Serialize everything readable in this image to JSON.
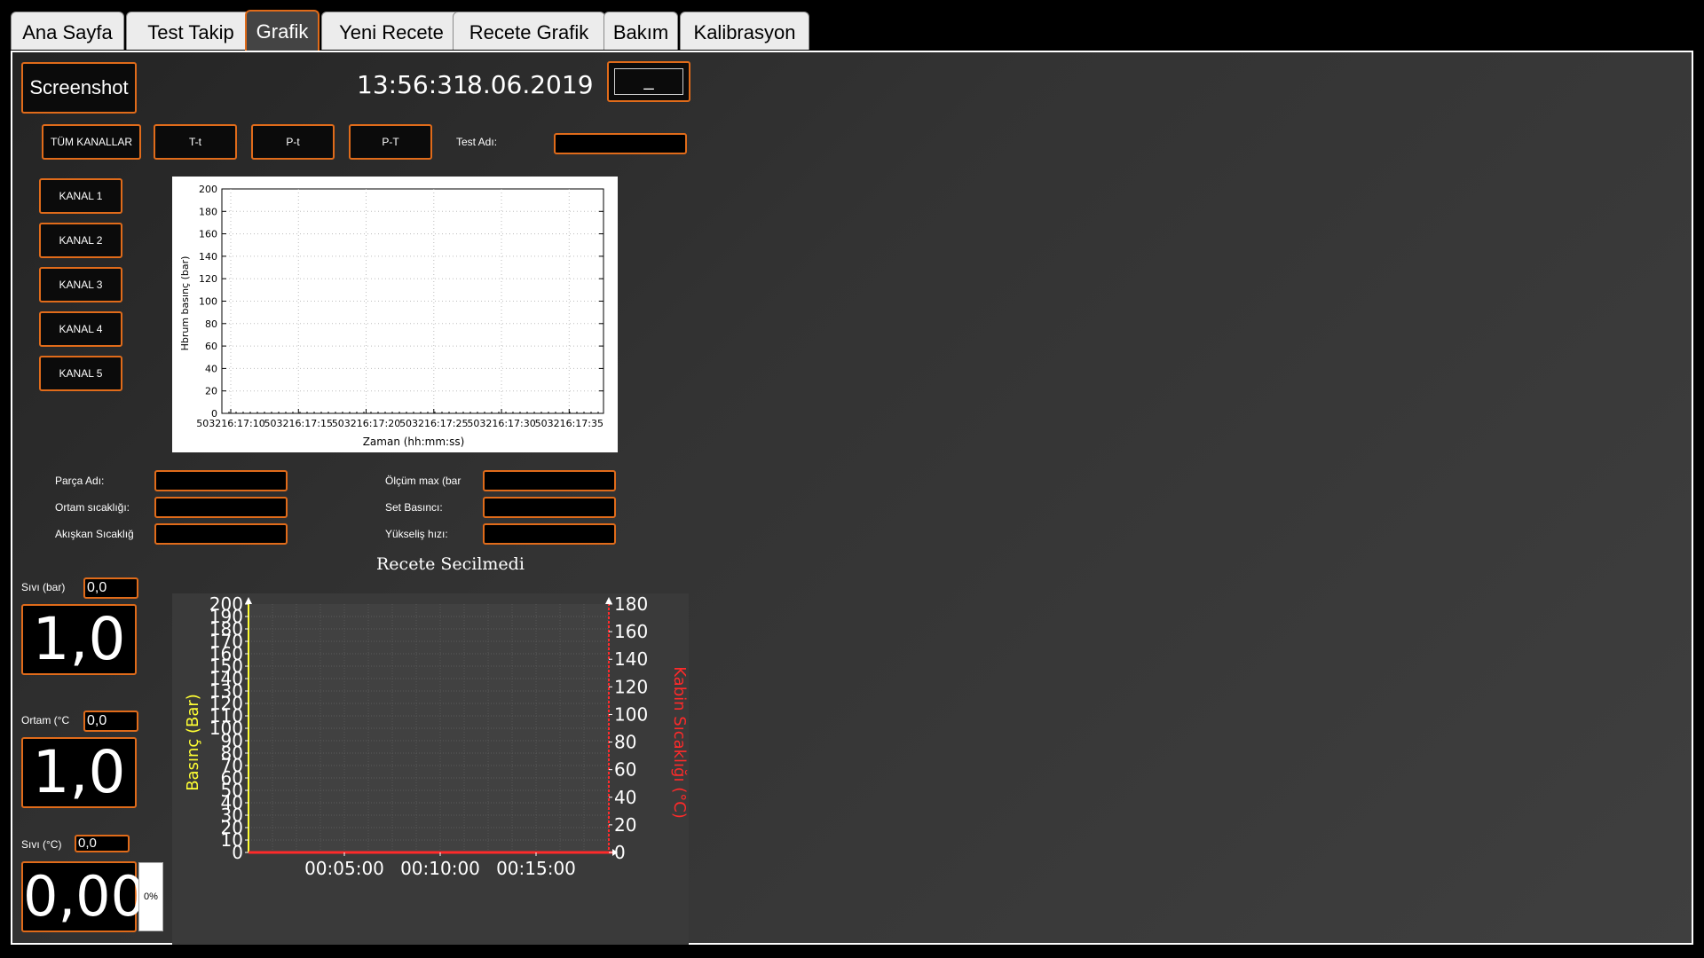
{
  "tabs": [
    "Ana Sayfa",
    "Test Takip",
    "Grafik",
    "Yeni Recete",
    "Recete Grafik",
    "Bakım",
    "Kalibrasyon"
  ],
  "active_tab": "Grafik",
  "screenshot_button": "Screenshot",
  "clock": {
    "time": "13:56:31",
    "date": "8.06.2019"
  },
  "minimize_button": "_",
  "channel_filters": [
    "TÜM KANALLAR",
    "T-t",
    "P-t",
    "P-T"
  ],
  "test_name_label": "Test Adı:",
  "test_name_value": "",
  "channels": [
    "KANAL 1",
    "KANAL 2",
    "KANAL 3",
    "KANAL 4",
    "KANAL 5"
  ],
  "form_left": [
    {
      "label": "Parça Adı:",
      "value": ""
    },
    {
      "label": "Ortam sıcaklığı:",
      "value": ""
    },
    {
      "label": "Akışkan Sıcaklığ",
      "value": ""
    }
  ],
  "form_right": [
    {
      "label": "Ölçüm max (bar",
      "value": ""
    },
    {
      "label": "Set Basıncı:",
      "value": ""
    },
    {
      "label": "Yükseliş hızı:",
      "value": ""
    }
  ],
  "recipe_title": "Recete Secilmedi",
  "readouts": [
    {
      "label": "Sıvı (bar)",
      "small": "0,0",
      "big": "1,0"
    },
    {
      "label": "Ortam (°C",
      "small": "0,0",
      "big": "1,0"
    },
    {
      "label": "Sıvı (°C)",
      "small": "0,0",
      "big": "0,00"
    }
  ],
  "level_percent_label": "0%",
  "level_percent": 0,
  "chart_data": [
    {
      "type": "line",
      "title": "",
      "xlabel": "Zaman (hh:mm:ss)",
      "ylabel": "Hbrum basınç (bar)",
      "ylim": [
        0,
        200
      ],
      "y_ticks": [
        0,
        20,
        40,
        60,
        80,
        100,
        120,
        140,
        160,
        180,
        200
      ],
      "x_ticks": [
        "503216:17:10",
        "503216:17:15",
        "503216:17:20",
        "503216:17:25",
        "503216:17:30",
        "503216:17:35"
      ],
      "grid": true,
      "series": []
    },
    {
      "type": "line",
      "title": "",
      "xlabel": "",
      "ylabel": "Basınç (Bar)",
      "y2label": "Kabin Sıcaklığı (°C)",
      "ylim": [
        0,
        200
      ],
      "y2lim": [
        0,
        180
      ],
      "y_ticks": [
        0,
        10,
        20,
        30,
        40,
        50,
        60,
        70,
        80,
        90,
        100,
        110,
        120,
        130,
        140,
        150,
        160,
        170,
        180,
        190,
        200
      ],
      "y2_ticks": [
        0,
        20,
        40,
        60,
        80,
        100,
        120,
        140,
        160,
        180
      ],
      "x_ticks": [
        "00:05:00",
        "00:10:00",
        "00:15:00"
      ],
      "grid": true,
      "colors": {
        "left_axis": "#ffff33",
        "right_axis": "#ff2a2a"
      },
      "series": []
    }
  ]
}
